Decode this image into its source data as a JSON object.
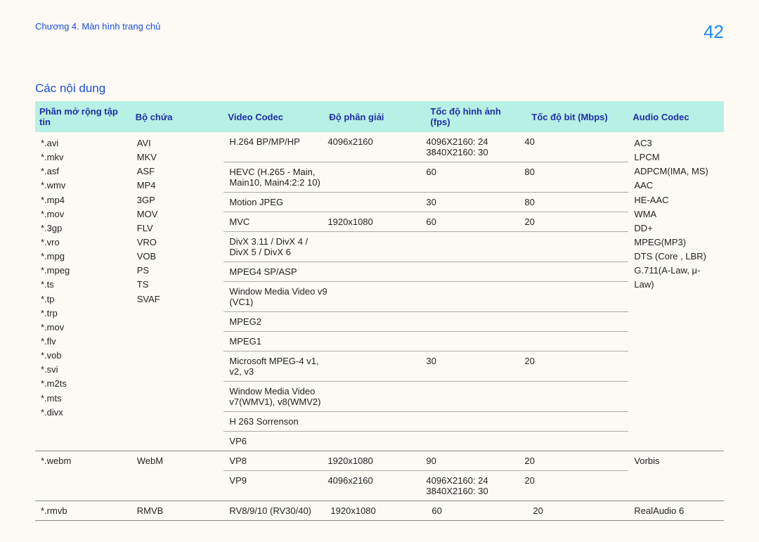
{
  "header": {
    "chapter": "Chương 4. Màn hình trang chủ",
    "page_number": "42"
  },
  "section_title": "Các nội dung",
  "columns": {
    "ext": "Phần mở rộng tập tin",
    "container": "Bộ chứa",
    "video": "Video Codec",
    "resolution": "Độ phân giải",
    "fps": "Tốc độ hình ảnh (fps)",
    "bitrate": "Tốc độ bit (Mbps)",
    "audio": "Audio Codec"
  },
  "row1": {
    "ext": "*.avi\n*.mkv\n*.asf\n*.wmv\n*.mp4\n*.mov\n*.3gp\n*.vro\n*.mpg\n*.mpeg\n*.ts\n*.tp\n*.trp\n*.mov\n*.flv\n*.vob\n*.svi\n*.m2ts\n*.mts\n *.divx",
    "container": "AVI\nMKV\nASF\nMP4\n3GP\nMOV\nFLV\nVRO\nVOB\nPS\nTS\nSVAF",
    "audio": "AC3\nLPCM\nADPCM(IMA, MS)\nAAC\nHE-AAC\nWMA\nDD+\nMPEG(MP3)\nDTS (Core , LBR)\nG.711(A-Law, μ-Law)",
    "codec1": {
      "name": "H.264 BP/MP/HP",
      "res": "4096x2160",
      "fps": "4096X2160: 24\n3840X2160: 30",
      "bit": "40"
    },
    "codec2": {
      "name": "HEVC (H.265 - Main, Main10, Main4:2:2 10)",
      "fps": "60",
      "bit": "80"
    },
    "codec3": {
      "name": "Motion JPEG",
      "fps": "30",
      "bit": "80"
    },
    "codec4": {
      "name": "MVC",
      "res": "1920x1080",
      "fps": "60",
      "bit": "20"
    },
    "codec5": {
      "name": "DivX 3.11 / DivX 4 / DivX 5 / DivX 6"
    },
    "codec6": {
      "name": "MPEG4 SP/ASP"
    },
    "codec7": {
      "name": "Window Media Video v9 (VC1)"
    },
    "codec8": {
      "name": "MPEG2"
    },
    "codec9": {
      "name": "MPEG1"
    },
    "codec10": {
      "name": "Microsoft MPEG-4 v1, v2, v3",
      "fps": "30",
      "bit": "20"
    },
    "codec11": {
      "name": "Window Media Video v7(WMV1), v8(WMV2)"
    },
    "codec12": {
      "name": "H 263 Sorrenson"
    },
    "codec13": {
      "name": "VP6"
    }
  },
  "row2": {
    "ext": "*.webm",
    "container": "WebM",
    "audio": "Vorbis",
    "sub1": {
      "name": "VP8",
      "res": "1920x1080",
      "fps": "90",
      "bit": "20"
    },
    "sub2": {
      "name": "VP9",
      "res": "4096x2160",
      "fps": "4096X2160: 24\n3840X2160: 30",
      "bit": "20"
    }
  },
  "row3": {
    "ext": "*.rmvb",
    "container": "RMVB",
    "video": "RV8/9/10 (RV30/40)",
    "res": "1920x1080",
    "fps": "60",
    "bit": "20",
    "audio": "RealAudio 6"
  }
}
